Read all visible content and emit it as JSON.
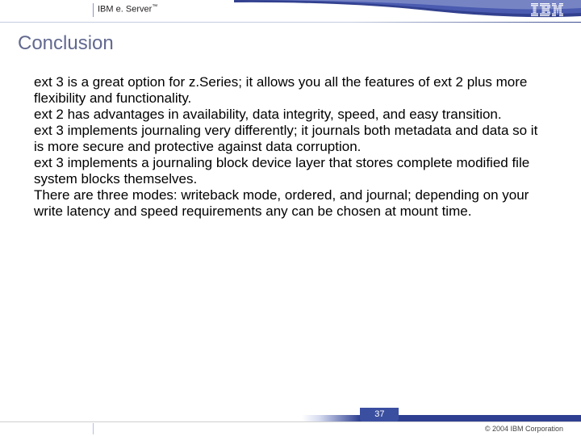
{
  "header": {
    "brand_prefix": "IBM ",
    "brand_e": "e",
    "brand_suffix": ". Server",
    "brand_tm": "™"
  },
  "title": "Conclusion",
  "body_text": "ext 3 is a great option for z.Series; it allows you all the features of ext 2 plus more flexibility and functionality.\next 2 has advantages in availability, data integrity, speed, and easy transition.\next 3 implements journaling very differently; it journals both metadata and data so it is more secure and protective against data corruption.\next 3 implements a journaling block device layer that stores complete modified file system blocks themselves.\nThere are three modes: writeback mode, ordered, and journal; depending on your write latency and speed requirements any can be chosen at mount time.",
  "footer": {
    "page_number": "37",
    "copyright": "© 2004 IBM Corporation"
  }
}
